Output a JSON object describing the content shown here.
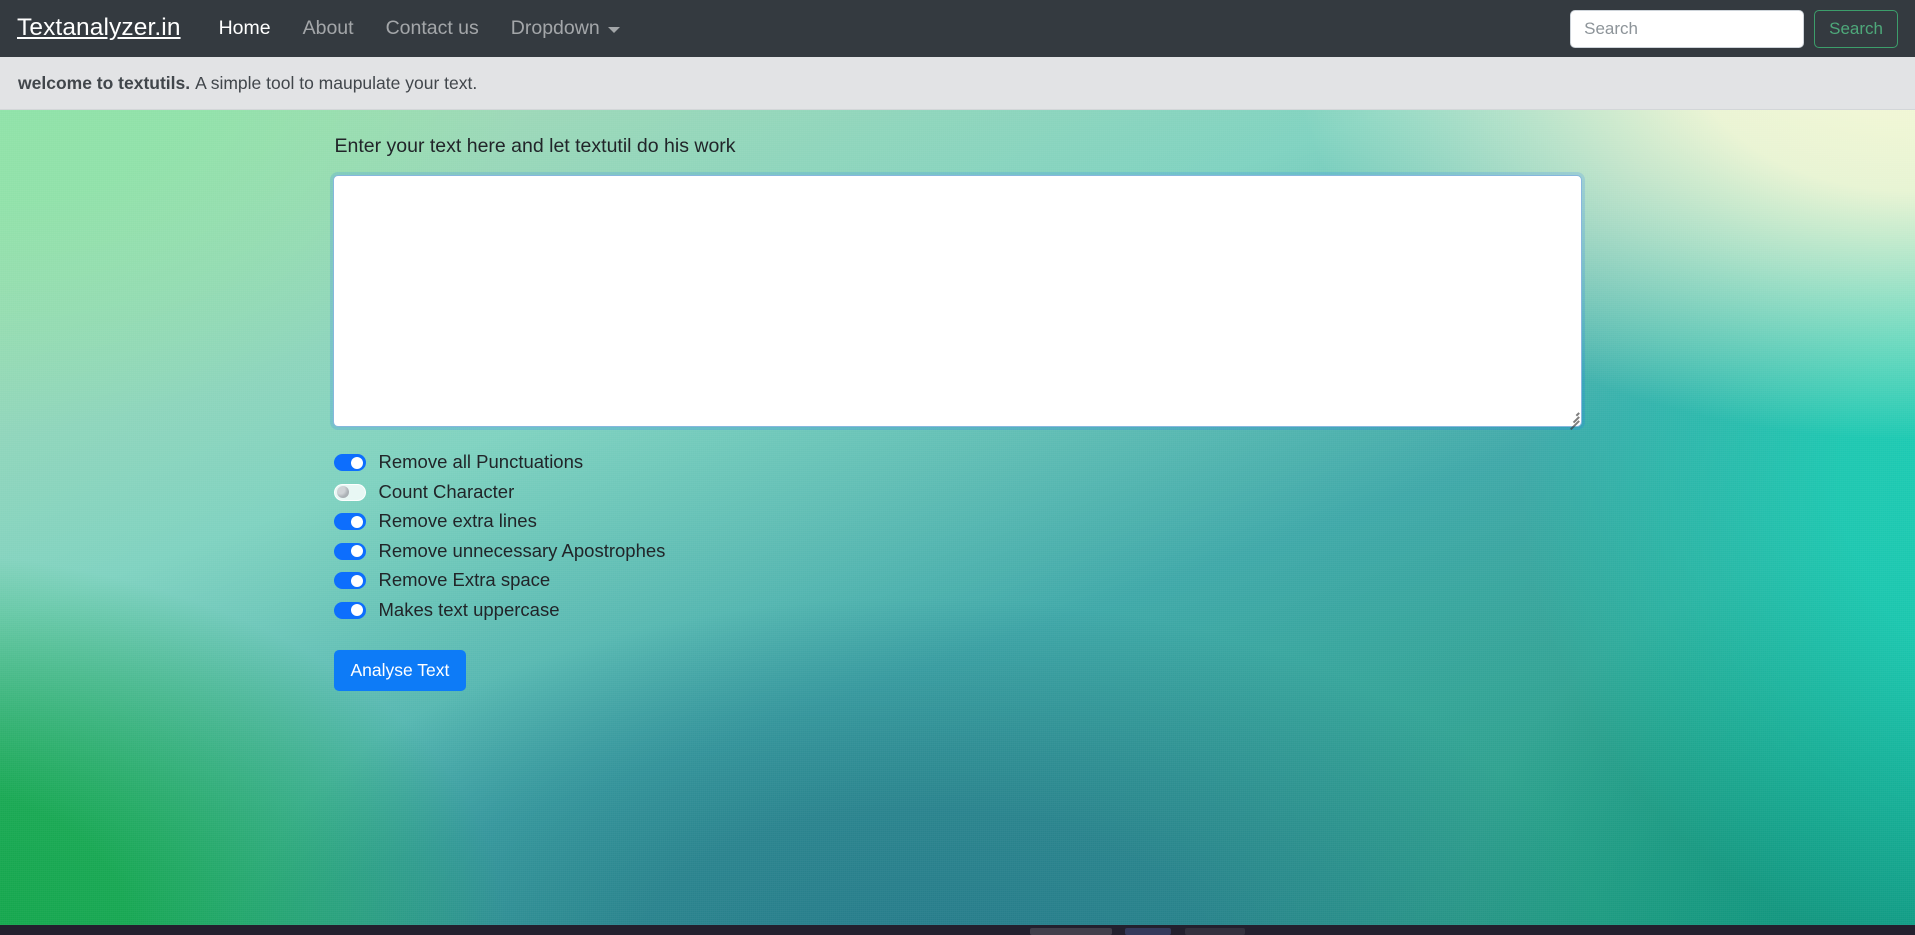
{
  "navbar": {
    "brand": "Textanalyzer.in",
    "links": [
      {
        "label": "Home",
        "active": true
      },
      {
        "label": "About",
        "active": false
      },
      {
        "label": "Contact us",
        "active": false
      },
      {
        "label": "Dropdown",
        "active": false,
        "has_caret": true
      }
    ],
    "search": {
      "placeholder": "Search",
      "value": "",
      "button_label": "Search",
      "button_color": "#4ea87a"
    },
    "background_color": "#343a40"
  },
  "alert": {
    "strong_text": "welcome to textutils.",
    "text": "A simple tool to maupulate your text.",
    "background_color": "#e2e3e5"
  },
  "main": {
    "section_title": "Enter your text here and let textutil do his work",
    "textarea": {
      "value": "",
      "placeholder": "",
      "focused": true,
      "border_color": "#86b7dd"
    },
    "switches": [
      {
        "label": "Remove all Punctuations",
        "on": true
      },
      {
        "label": "Count Character",
        "on": false
      },
      {
        "label": "Remove extra lines",
        "on": true
      },
      {
        "label": "Remove unnecessary Apostrophes",
        "on": true
      },
      {
        "label": "Remove Extra space",
        "on": true
      },
      {
        "label": "Makes text uppercase",
        "on": true
      }
    ],
    "analyse_button": {
      "label": "Analyse Text",
      "color": "#0d7bf7"
    }
  },
  "theme": {
    "switch_on_color": "#0d6efd",
    "background_gradient_stops": [
      "#8de2a7",
      "#f6f8d6",
      "#19cdb4",
      "#12a649",
      "#267b8a",
      "#109680"
    ]
  }
}
